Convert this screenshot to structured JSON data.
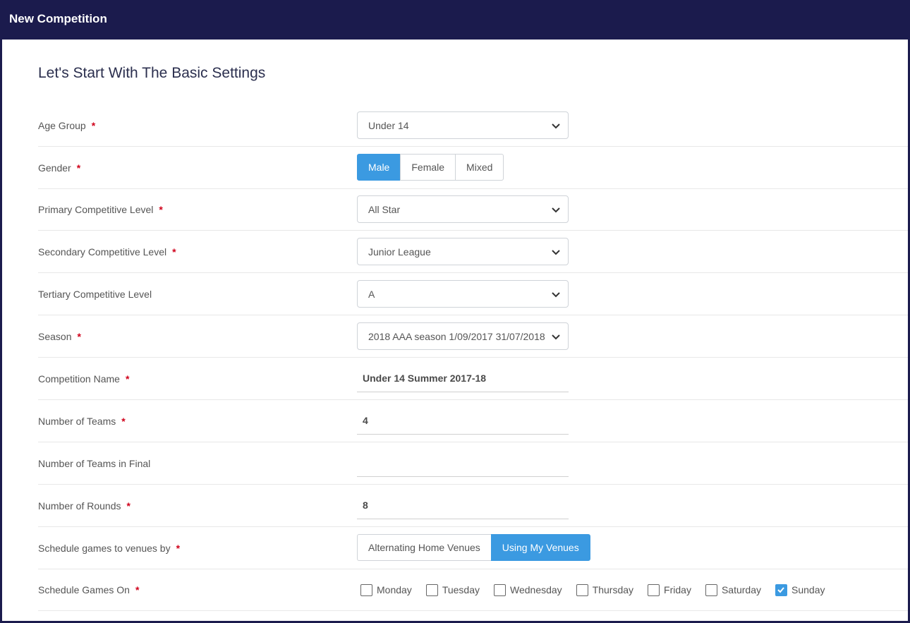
{
  "window": {
    "title": "New Competition"
  },
  "section_heading": "Let's Start With The Basic Settings",
  "required_mark": "*",
  "fields": {
    "age_group": {
      "label": "Age Group",
      "value": "Under 14",
      "required": true
    },
    "gender": {
      "label": "Gender",
      "options": [
        "Male",
        "Female",
        "Mixed"
      ],
      "selected": "Male",
      "required": true
    },
    "primary_level": {
      "label": "Primary Competitive Level",
      "value": "All Star",
      "required": true
    },
    "secondary_level": {
      "label": "Secondary Competitive Level",
      "value": "Junior League",
      "required": true
    },
    "tertiary_level": {
      "label": "Tertiary Competitive Level",
      "value": "A",
      "required": false
    },
    "season": {
      "label": "Season",
      "value": "2018 AAA season 1/09/2017 31/07/2018",
      "required": true
    },
    "competition_name": {
      "label": "Competition Name",
      "value": "Under 14 Summer 2017-18",
      "required": true
    },
    "num_teams": {
      "label": "Number of Teams",
      "value": "4",
      "required": true
    },
    "num_teams_final": {
      "label": "Number of Teams in Final",
      "value": "",
      "required": false
    },
    "num_rounds": {
      "label": "Number of Rounds",
      "value": "8",
      "required": true
    },
    "schedule_venues": {
      "label": "Schedule games to venues by",
      "options": [
        "Alternating Home Venues",
        "Using My Venues"
      ],
      "selected": "Using My Venues",
      "required": true
    },
    "schedule_days": {
      "label": "Schedule Games On",
      "required": true,
      "days": [
        {
          "name": "Monday",
          "checked": false
        },
        {
          "name": "Tuesday",
          "checked": false
        },
        {
          "name": "Wednesday",
          "checked": false
        },
        {
          "name": "Thursday",
          "checked": false
        },
        {
          "name": "Friday",
          "checked": false
        },
        {
          "name": "Saturday",
          "checked": false
        },
        {
          "name": "Sunday",
          "checked": true
        }
      ]
    }
  },
  "colors": {
    "header_bg": "#1b1b4d",
    "accent": "#3b9ae1",
    "required": "#d0021b"
  },
  "icons": {
    "select_arrow": "chevron-down-icon",
    "checkmark": "check-icon"
  }
}
